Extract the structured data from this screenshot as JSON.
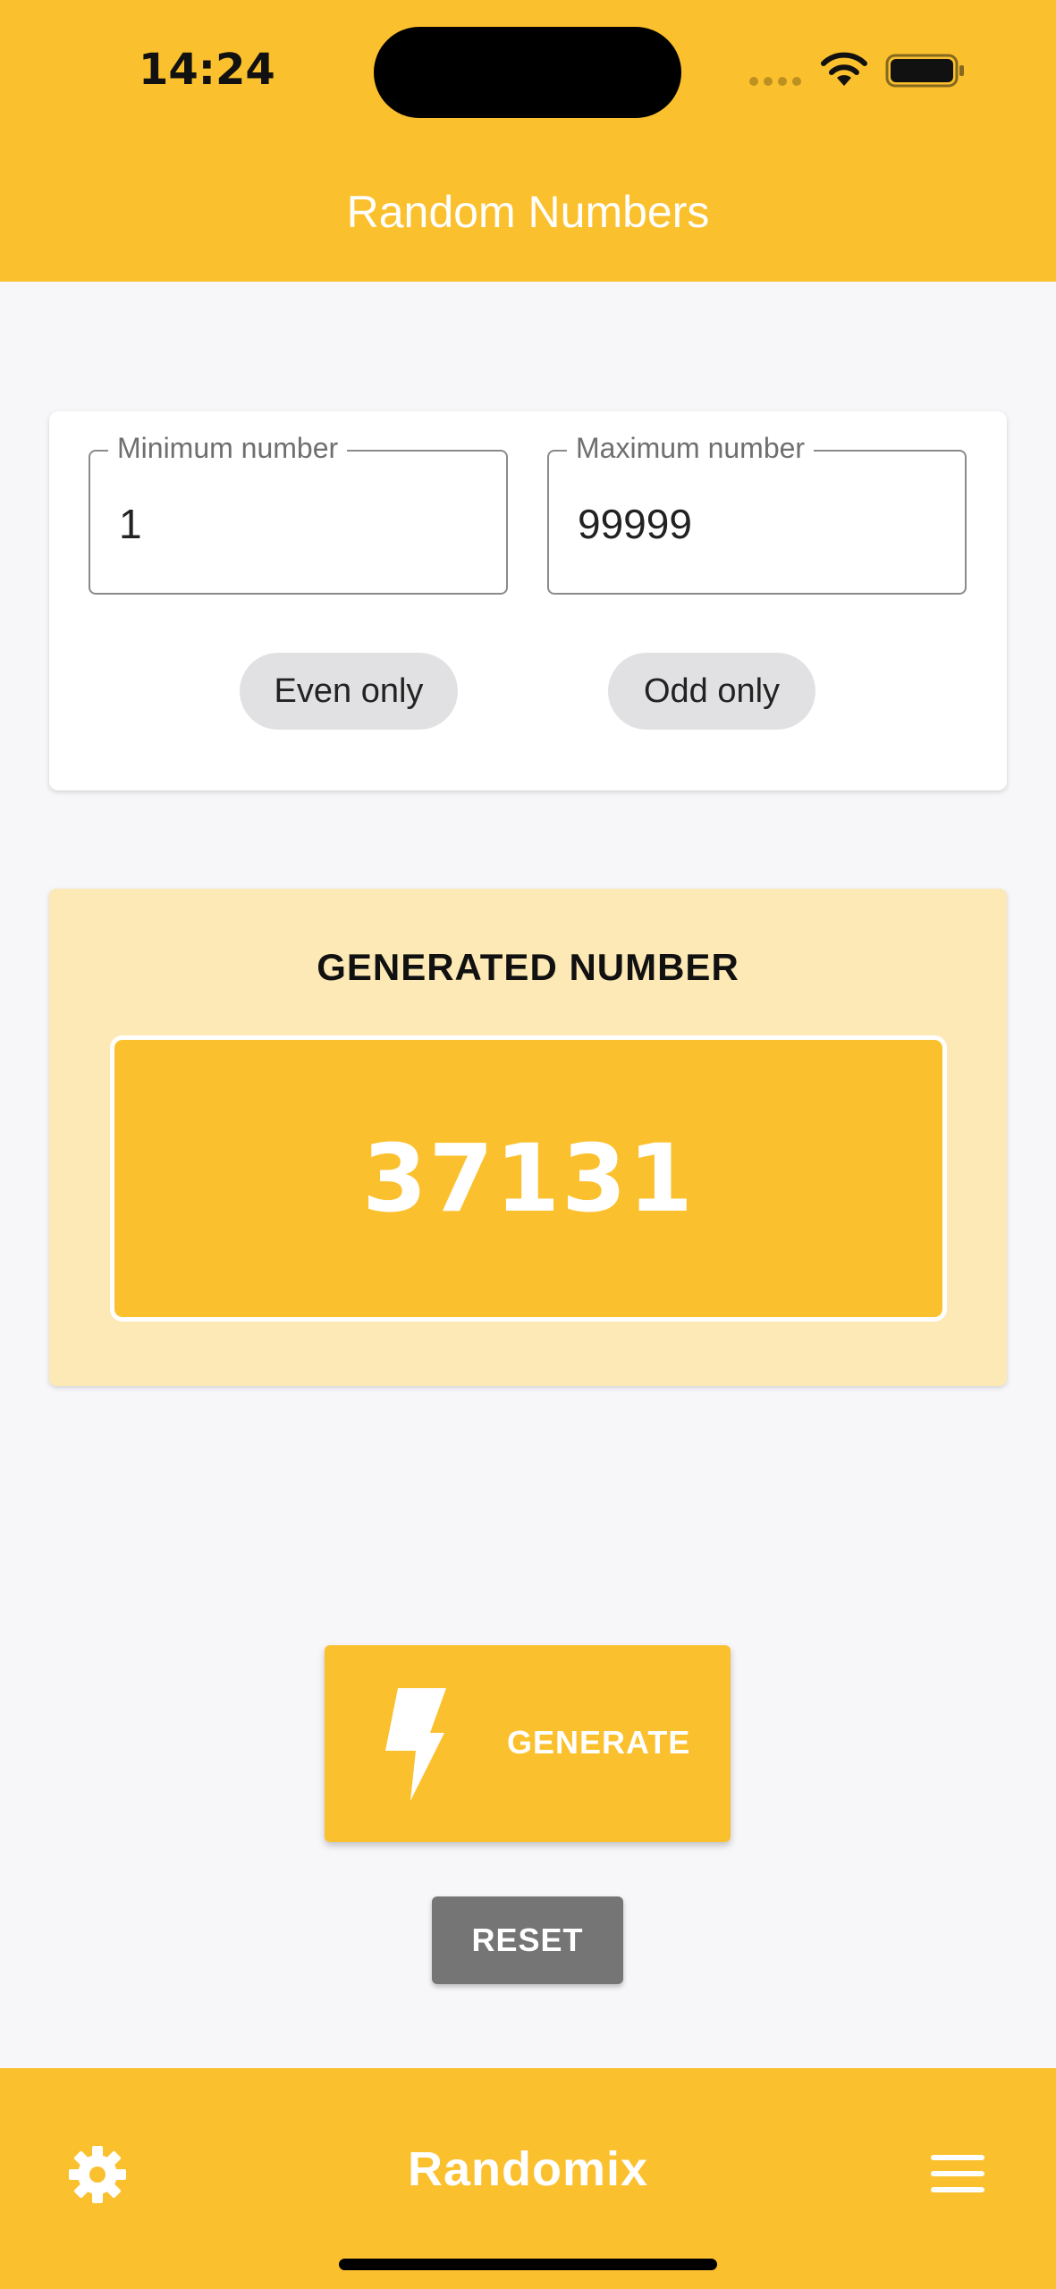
{
  "status_bar": {
    "time": "14:24"
  },
  "app_bar": {
    "title": "Random Numbers"
  },
  "range": {
    "min": {
      "label": "Minimum number",
      "value": "1"
    },
    "max": {
      "label": "Maximum number",
      "value": "99999"
    },
    "chips": {
      "even": "Even only",
      "odd": "Odd only"
    }
  },
  "result": {
    "heading": "GENERATED NUMBER",
    "value": "37131"
  },
  "actions": {
    "generate": "GENERATE",
    "reset": "RESET"
  },
  "bottom_bar": {
    "brand": "Randomix",
    "left_icon": "gear-icon",
    "right_icon": "menu-icon"
  },
  "colors": {
    "accent": "#fbc02d",
    "result_card": "#fde9b5",
    "reset": "#757575",
    "chip": "#e1e1e3"
  }
}
